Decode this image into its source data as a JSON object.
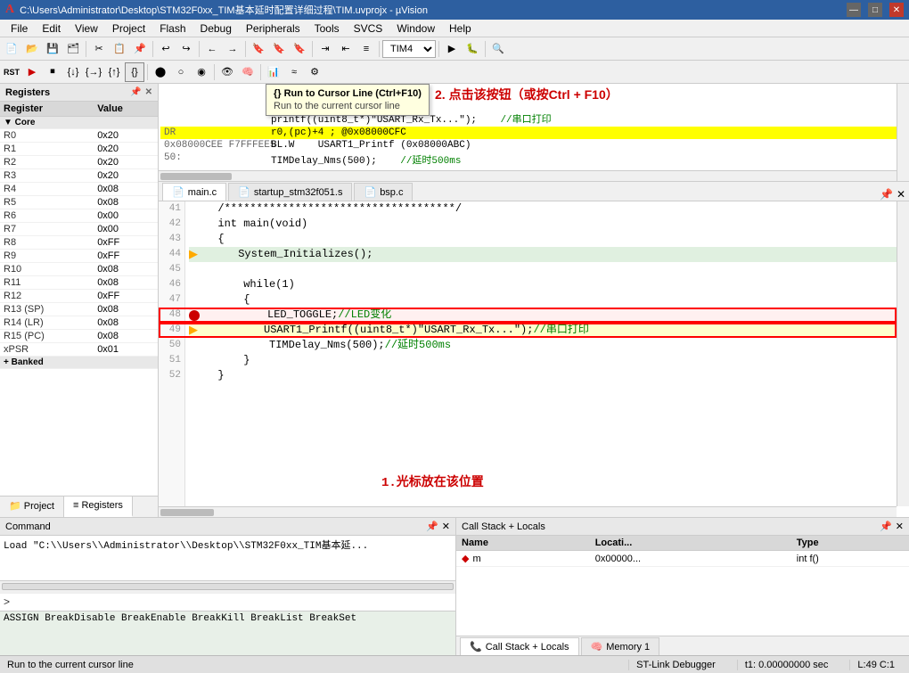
{
  "titlebar": {
    "title": "C:\\Users\\Administrator\\Desktop\\STM32F0xx_TIM基本延时配置详细过程\\TIM.uvprojx - µVision",
    "logo": "A",
    "min": "—",
    "max": "□",
    "close": "✕"
  },
  "menubar": {
    "items": [
      "File",
      "Edit",
      "View",
      "Project",
      "Flash",
      "Debug",
      "Peripherals",
      "Tools",
      "SVCS",
      "Window",
      "Help"
    ]
  },
  "toolbar1": {
    "combo": "TIM4"
  },
  "registers": {
    "title": "Registers",
    "columns": [
      "Register",
      "Value"
    ],
    "core_label": "Core",
    "rows": [
      {
        "name": "R0",
        "value": "0x20"
      },
      {
        "name": "R1",
        "value": "0x20"
      },
      {
        "name": "R2",
        "value": "0x20"
      },
      {
        "name": "R3",
        "value": "0x20"
      },
      {
        "name": "R4",
        "value": "0x08"
      },
      {
        "name": "R5",
        "value": "0x08"
      },
      {
        "name": "R6",
        "value": "0x00"
      },
      {
        "name": "R7",
        "value": "0x00"
      },
      {
        "name": "R8",
        "value": "0xFF"
      },
      {
        "name": "R9",
        "value": "0xFF"
      },
      {
        "name": "R10",
        "value": "0x08"
      },
      {
        "name": "R11",
        "value": "0x08"
      },
      {
        "name": "R12",
        "value": "0xFF"
      },
      {
        "name": "R13 (SP)",
        "value": "0x08"
      },
      {
        "name": "R14 (LR)",
        "value": "0x08"
      },
      {
        "name": "R15 (PC)",
        "value": "0x08"
      },
      {
        "name": "xPSR",
        "value": "0x01"
      }
    ],
    "banked": "Banked",
    "tabs": [
      "Project",
      "Registers"
    ]
  },
  "tooltip": {
    "title": "{} Run to Cursor Line (Ctrl+F10)",
    "desc": "Run to the current cursor line"
  },
  "disasm": {
    "lines": [
      {
        "addr": "",
        "code": "printf((uint8_t*)\"USART_Rx_Tx...\");",
        "comment": "//串口打印"
      },
      {
        "addr": "DR",
        "code": "r0,(pc)+4 ; @0x08000CFC",
        "comment": "",
        "highlighted": true
      },
      {
        "addr": "0x08000CEE F7FFFEE5",
        "code": "BL.W    USART1_Printf (0x08000ABC)",
        "comment": ""
      },
      {
        "addr": "50:",
        "code": "TIMDelay_Nms(500);",
        "comment": "//延时500ms"
      }
    ],
    "annotation": "2. 点击该按钮（或按Ctrl + F10）"
  },
  "code_tabs": [
    "main.c",
    "startup_stm32f051.s",
    "bsp.c"
  ],
  "code_lines": [
    {
      "num": 41,
      "content": "  /************************************/",
      "type": "normal"
    },
    {
      "num": 42,
      "content": "  int main(void)",
      "type": "normal"
    },
    {
      "num": 43,
      "content": "  {",
      "type": "normal"
    },
    {
      "num": 44,
      "content": "      System_Initializes();",
      "type": "current",
      "has_arrow": true
    },
    {
      "num": 45,
      "content": "",
      "type": "normal"
    },
    {
      "num": 46,
      "content": "      while(1)",
      "type": "normal"
    },
    {
      "num": 47,
      "content": "      {",
      "type": "normal"
    },
    {
      "num": 48,
      "content": "          LED_TOGGLE;",
      "type": "breakpoint",
      "comment": "//LED变化"
    },
    {
      "num": 49,
      "content": "          USART1_Printf((uint8_t*)\"USART_Rx_Tx...\");",
      "type": "highlighted",
      "comment": "//串口打印",
      "has_arrow": true
    },
    {
      "num": 50,
      "content": "          TIMDelay_Nms(500);",
      "type": "normal",
      "comment": "//延时500ms"
    },
    {
      "num": 51,
      "content": "      }",
      "type": "normal"
    },
    {
      "num": 52,
      "content": "  }",
      "type": "normal"
    }
  ],
  "code_annotation": "1.光标放在该位置",
  "command": {
    "title": "Command",
    "output": [
      "Load \"C:\\\\Users\\\\Administrator\\\\Desktop\\\\STM32F0xx_TIM基本延..."
    ],
    "autocomplete": "ASSIGN BreakDisable BreakEnable BreakKill BreakList BreakSet",
    "prompt": ">"
  },
  "callstack": {
    "title": "Call Stack + Locals",
    "columns": [
      "Name",
      "Locati...",
      "Type"
    ],
    "rows": [
      {
        "name": "m",
        "location": "0x00000...",
        "type": "int f()"
      }
    ]
  },
  "bottom_tabs": [
    {
      "label": "Call Stack + Locals",
      "icon": "📞"
    },
    {
      "label": "Memory 1",
      "icon": "🧠"
    }
  ],
  "statusbar": {
    "message": "Run to the current cursor line",
    "debugger": "ST-Link Debugger",
    "time": "t1: 0.00000000 sec",
    "position": "L:49 C:1"
  }
}
